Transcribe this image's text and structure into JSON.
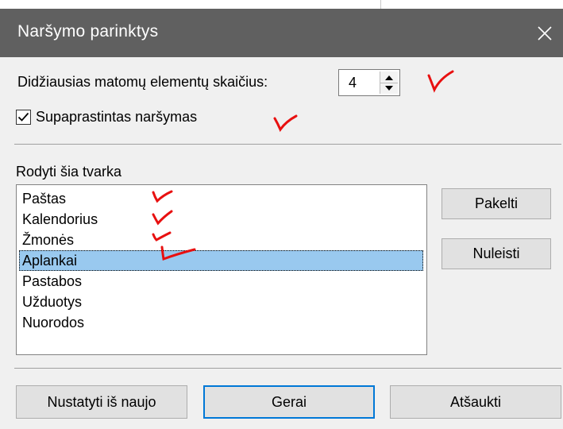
{
  "dialog": {
    "title": "Naršymo parinktys",
    "close_icon": "close-icon"
  },
  "max_items": {
    "label": "Didžiausias matomų elementų skaičius:",
    "value": "4"
  },
  "simplified": {
    "label": "Supaprastintas naršymas",
    "checked": true
  },
  "order": {
    "label": "Rodyti šia tvarka",
    "items": [
      {
        "label": "Paštas"
      },
      {
        "label": "Kalendorius"
      },
      {
        "label": "Žmonės"
      },
      {
        "label": "Aplankai",
        "selected": true
      },
      {
        "label": "Pastabos"
      },
      {
        "label": "Užduotys"
      },
      {
        "label": "Nuorodos"
      }
    ]
  },
  "buttons": {
    "move_up": "Pakelti",
    "move_down": "Nuleisti",
    "reset": "Nustatyti iš naujo",
    "ok": "Gerai",
    "cancel": "Atšaukti"
  },
  "colors": {
    "titlebar": "#606060",
    "selection": "#99c9ef",
    "default_button_border": "#0078d7",
    "annotation_marks": "#e81010"
  }
}
